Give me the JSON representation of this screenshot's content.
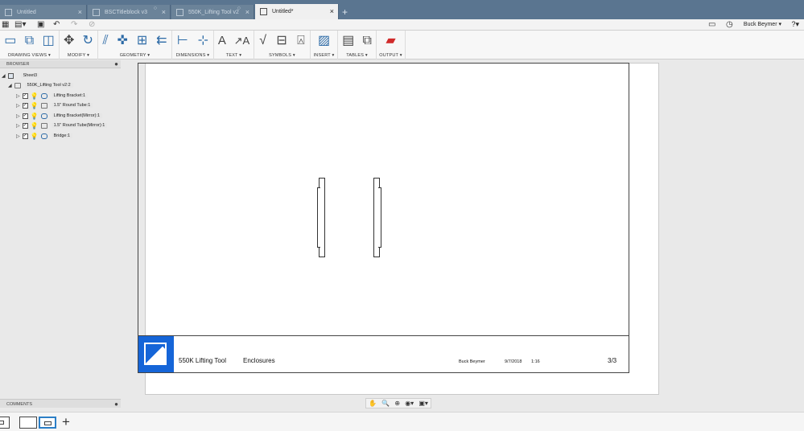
{
  "tabs": [
    {
      "label": "Untitled",
      "active": false
    },
    {
      "label": "BSCTitleblock v3",
      "active": false
    },
    {
      "label": "550K_Lifting Tool v2",
      "active": false
    },
    {
      "label": "Untitled*",
      "active": true
    }
  ],
  "quick_access": {
    "user_name": "Buck Beymer ▾",
    "help": "?▾"
  },
  "ribbon": {
    "groups": [
      {
        "label": "DRAWING VIEWS ▾"
      },
      {
        "label": "MODIFY ▾"
      },
      {
        "label": "GEOMETRY ▾"
      },
      {
        "label": "DIMENSIONS ▾"
      },
      {
        "label": "TEXT ▾"
      },
      {
        "label": "SYMBOLS ▾"
      },
      {
        "label": "INSERT ▾"
      },
      {
        "label": "TABLES ▾"
      },
      {
        "label": "OUTPUT ▾"
      }
    ]
  },
  "browser": {
    "title": "BROWSER",
    "sheet": "Sheet3",
    "document": "550K_Lifting Tool v2:2",
    "components": [
      {
        "label": "Lifting Bracket:1",
        "kind": "body"
      },
      {
        "label": "1.5\" Round Tube:1",
        "kind": "tube"
      },
      {
        "label": "Lifting Bracket(Mirror):1",
        "kind": "body"
      },
      {
        "label": "1.5\" Round Tube(Mirror):1",
        "kind": "tube"
      },
      {
        "label": "Bridge:1",
        "kind": "body"
      }
    ]
  },
  "comments": {
    "title": "COMMENTS"
  },
  "title_block": {
    "title": "550K  Lifting Tool",
    "subtitle": "Enclosures",
    "author": "Buck Beymer",
    "date": "9/7/2018",
    "scale": "1:16",
    "sheet": "3/3"
  },
  "colors": {
    "tabbar": "#5a7590",
    "accent": "#2c6aa6",
    "logo": "#1565d8"
  }
}
